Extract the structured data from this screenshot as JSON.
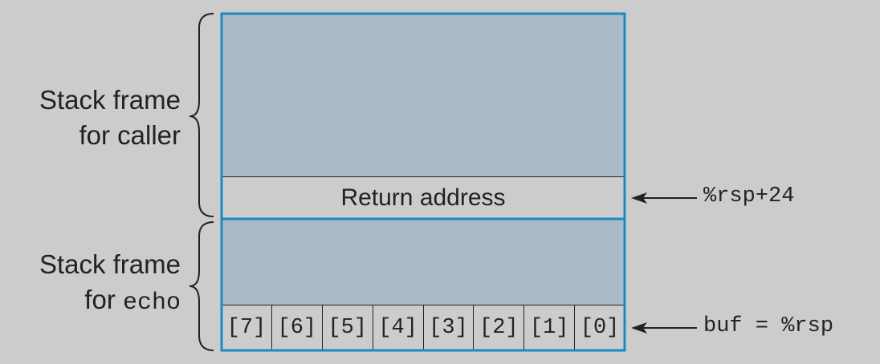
{
  "labels": {
    "caller_line1": "Stack frame",
    "caller_line2": "for caller",
    "echo_line1": "Stack frame",
    "echo_prefix": "for ",
    "echo_word": "echo"
  },
  "return_address": "Return address",
  "buffer_cells": [
    "[7]",
    "[6]",
    "[5]",
    "[4]",
    "[3]",
    "[2]",
    "[1]",
    "[0]"
  ],
  "pointers": {
    "return": "%rsp+24",
    "buf": "buf = %rsp"
  },
  "colors": {
    "background": "#cccccc",
    "frame_fill": "#a9bbc7",
    "frame_border": "#1a8ac4",
    "ink": "#222222"
  }
}
